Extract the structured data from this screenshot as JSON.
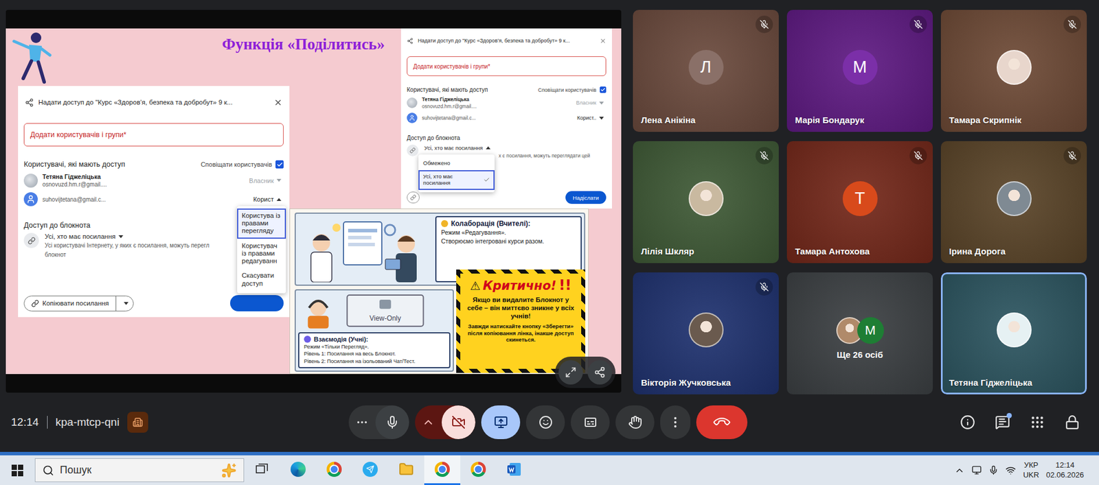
{
  "meeting": {
    "time": "12:14",
    "code": "kpa-mtcp-qni"
  },
  "controls": {
    "mic_on": true,
    "camera_on": false,
    "presenting": true,
    "chat_unread": true
  },
  "slide": {
    "title": "Функція «Поділитись»",
    "dialogs": [
      {
        "size": "large",
        "title": "Надати доступ до \"Курс «Здоров’я, безпека та добробут» 9 к...",
        "input_placeholder": "Додати користувачів і групи*",
        "access_heading": "Користувачі, які мають доступ",
        "notify": {
          "label": "Сповіщати користувачів",
          "checked": true
        },
        "users": [
          {
            "name": "Тетяна Гіджеліцька",
            "email": "osnovuzd.hm.r@gmail....",
            "role": "Власник",
            "disabled": true,
            "expanded": false,
            "kind": "photo",
            "menu": []
          },
          {
            "name": "",
            "email": "suhovijtetana@gmail.c...",
            "role": "Корист",
            "disabled": false,
            "expanded": true,
            "kind": "person",
            "menu": [
              {
                "label": "Користува із правами перегляду",
                "selected": true
              },
              {
                "label": "Користувач із правами редагуванн",
                "selected": false
              },
              {
                "label": "Скасувати доступ",
                "selected": false
              }
            ]
          }
        ],
        "general": {
          "heading": "Доступ до блокнота",
          "value": "Усі, хто має посилання",
          "expanded": false,
          "menu": [],
          "desc": [
            "Усі користувачі Інтернету, у яких є посилання, можуть перегл",
            "блокнот"
          ]
        },
        "footer": {
          "copy_label": "Копіювати посилання",
          "send_label": ""
        }
      },
      {
        "size": "small",
        "title": "Надати доступ до \"Курс «Здоров’я, безпека та добробут» 9 к...",
        "input_placeholder": "Додати користувачів і групи*",
        "access_heading": "Користувачі, які мають доступ",
        "notify": {
          "label": "Сповіщати користувачів",
          "checked": true
        },
        "users": [
          {
            "name": "Тетяна Гіджеліцька",
            "email": "osnovuzd.hm.r@gmail....",
            "role": "Власник",
            "disabled": true,
            "expanded": false,
            "kind": "photo",
            "menu": []
          },
          {
            "name": "",
            "email": "suhovijtetana@gmail.c...",
            "role": "Корист..",
            "disabled": false,
            "expanded": false,
            "kind": "person",
            "menu": []
          }
        ],
        "general": {
          "heading": "Доступ до блокнота",
          "value": "Усі, хто має посилання",
          "expanded": true,
          "menu": [
            {
              "label": "Обмежено",
              "selected": false
            },
            {
              "label": "Усі, хто має посилання",
              "selected": true
            }
          ],
          "desc": [
            "х є посилання, можуть переглядати цей"
          ]
        },
        "footer": {
          "copy_label": "",
          "send_label": "Надіслати"
        }
      }
    ],
    "comic": {
      "teachers": {
        "heading": "Колаборація (Вчителі):",
        "lines": [
          "Режим «Редагування».",
          "Створюємо інтегровані курси разом."
        ]
      },
      "students": {
        "heading": "Взаємодія (Учні):",
        "screen_label": "View-Only",
        "lines": [
          "Режим «Тільки Перегляд».",
          "Рівень 1: Посилання на весь Блокнот.",
          "Рівень 2: Посилання на ізольований Чат/Тест."
        ]
      },
      "warning": {
        "icon": "⚠",
        "title": "Критично!",
        "exclaim": "!!",
        "lines": [
          "Якщо ви видалите Блокнот у себе – він миттєво зникне у всіх учнів!",
          "Завжди натискайте кнопку «Зберегти» після копіювання лінка, інакше доступ скинеться."
        ]
      }
    }
  },
  "participants": [
    {
      "kind": "letter",
      "name": "Лена Анікіна",
      "initial": "Л",
      "muted": true,
      "active": false,
      "color": "#6b4a3d",
      "avatar_color": "#8a7068",
      "avatars": []
    },
    {
      "kind": "letter",
      "name": "Марія Бондарук",
      "initial": "М",
      "muted": true,
      "active": false,
      "color": "#5f1a83",
      "avatar_color": "#7b2fa8",
      "avatars": []
    },
    {
      "kind": "photo",
      "name": "Тамара Скрипнік",
      "initial": "",
      "muted": true,
      "active": false,
      "color": "#6e4a36",
      "avatar_color": "#e8d6cc",
      "avatars": []
    },
    {
      "kind": "photo",
      "name": "Лілія Шкляр",
      "initial": "",
      "muted": true,
      "active": false,
      "color": "#3f5a36",
      "avatar_color": "#c9b9a0",
      "avatars": []
    },
    {
      "kind": "letter",
      "name": "Тамара Антохова",
      "initial": "Т",
      "muted": true,
      "active": false,
      "color": "#74281a",
      "avatar_color": "#d84a1b",
      "avatars": []
    },
    {
      "kind": "photo",
      "name": "Ірина Дорога",
      "initial": "",
      "muted": true,
      "active": false,
      "color": "#5a4428",
      "avatar_color": "#7f8a93",
      "avatars": []
    },
    {
      "kind": "photo",
      "name": "Вікторія Жучковська",
      "initial": "",
      "muted": true,
      "active": false,
      "color": "#1f3270",
      "avatar_color": "#6a5a4e",
      "avatars": []
    },
    {
      "kind": "more",
      "name": "Ще 26 осіб",
      "initial": "",
      "muted": false,
      "active": false,
      "color": "#3c4043",
      "avatar_color": "#3c4043",
      "avatars": [
        {
          "kind": "photo",
          "initial": "",
          "avatar_color": "#b08a6a"
        },
        {
          "kind": "letter",
          "initial": "М",
          "avatar_color": "#1e7e34"
        }
      ]
    },
    {
      "kind": "photo",
      "name": "Тетяна Гіджеліцька",
      "initial": "",
      "muted": false,
      "active": true,
      "color": "#2c5560",
      "avatar_color": "#e6f1f3",
      "avatars": []
    }
  ],
  "taskbar": {
    "search_placeholder": "Пошук",
    "apps": [
      {
        "kind": "task-view",
        "selected": false
      },
      {
        "kind": "edge",
        "selected": false
      },
      {
        "kind": "chrome",
        "selected": false
      },
      {
        "kind": "telegram",
        "selected": false
      },
      {
        "kind": "files",
        "selected": false
      },
      {
        "kind": "chrome",
        "selected": true
      },
      {
        "kind": "chrome",
        "selected": false
      },
      {
        "kind": "word",
        "selected": false
      }
    ],
    "lang": "УКР",
    "lang_sub": "UKR",
    "time": "12:14",
    "date": "02.06.2026"
  }
}
